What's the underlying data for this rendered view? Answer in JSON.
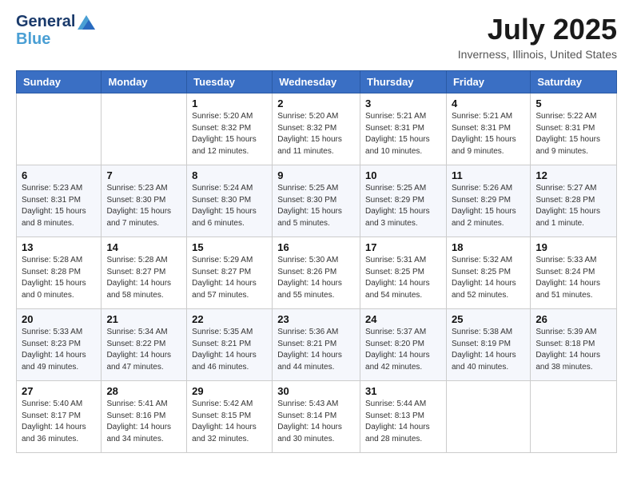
{
  "header": {
    "logo_line1": "General",
    "logo_line2": "Blue",
    "month_title": "July 2025",
    "location": "Inverness, Illinois, United States"
  },
  "weekdays": [
    "Sunday",
    "Monday",
    "Tuesday",
    "Wednesday",
    "Thursday",
    "Friday",
    "Saturday"
  ],
  "weeks": [
    [
      {
        "day": "",
        "info": ""
      },
      {
        "day": "",
        "info": ""
      },
      {
        "day": "1",
        "info": "Sunrise: 5:20 AM\nSunset: 8:32 PM\nDaylight: 15 hours and 12 minutes."
      },
      {
        "day": "2",
        "info": "Sunrise: 5:20 AM\nSunset: 8:32 PM\nDaylight: 15 hours and 11 minutes."
      },
      {
        "day": "3",
        "info": "Sunrise: 5:21 AM\nSunset: 8:31 PM\nDaylight: 15 hours and 10 minutes."
      },
      {
        "day": "4",
        "info": "Sunrise: 5:21 AM\nSunset: 8:31 PM\nDaylight: 15 hours and 9 minutes."
      },
      {
        "day": "5",
        "info": "Sunrise: 5:22 AM\nSunset: 8:31 PM\nDaylight: 15 hours and 9 minutes."
      }
    ],
    [
      {
        "day": "6",
        "info": "Sunrise: 5:23 AM\nSunset: 8:31 PM\nDaylight: 15 hours and 8 minutes."
      },
      {
        "day": "7",
        "info": "Sunrise: 5:23 AM\nSunset: 8:30 PM\nDaylight: 15 hours and 7 minutes."
      },
      {
        "day": "8",
        "info": "Sunrise: 5:24 AM\nSunset: 8:30 PM\nDaylight: 15 hours and 6 minutes."
      },
      {
        "day": "9",
        "info": "Sunrise: 5:25 AM\nSunset: 8:30 PM\nDaylight: 15 hours and 5 minutes."
      },
      {
        "day": "10",
        "info": "Sunrise: 5:25 AM\nSunset: 8:29 PM\nDaylight: 15 hours and 3 minutes."
      },
      {
        "day": "11",
        "info": "Sunrise: 5:26 AM\nSunset: 8:29 PM\nDaylight: 15 hours and 2 minutes."
      },
      {
        "day": "12",
        "info": "Sunrise: 5:27 AM\nSunset: 8:28 PM\nDaylight: 15 hours and 1 minute."
      }
    ],
    [
      {
        "day": "13",
        "info": "Sunrise: 5:28 AM\nSunset: 8:28 PM\nDaylight: 15 hours and 0 minutes."
      },
      {
        "day": "14",
        "info": "Sunrise: 5:28 AM\nSunset: 8:27 PM\nDaylight: 14 hours and 58 minutes."
      },
      {
        "day": "15",
        "info": "Sunrise: 5:29 AM\nSunset: 8:27 PM\nDaylight: 14 hours and 57 minutes."
      },
      {
        "day": "16",
        "info": "Sunrise: 5:30 AM\nSunset: 8:26 PM\nDaylight: 14 hours and 55 minutes."
      },
      {
        "day": "17",
        "info": "Sunrise: 5:31 AM\nSunset: 8:25 PM\nDaylight: 14 hours and 54 minutes."
      },
      {
        "day": "18",
        "info": "Sunrise: 5:32 AM\nSunset: 8:25 PM\nDaylight: 14 hours and 52 minutes."
      },
      {
        "day": "19",
        "info": "Sunrise: 5:33 AM\nSunset: 8:24 PM\nDaylight: 14 hours and 51 minutes."
      }
    ],
    [
      {
        "day": "20",
        "info": "Sunrise: 5:33 AM\nSunset: 8:23 PM\nDaylight: 14 hours and 49 minutes."
      },
      {
        "day": "21",
        "info": "Sunrise: 5:34 AM\nSunset: 8:22 PM\nDaylight: 14 hours and 47 minutes."
      },
      {
        "day": "22",
        "info": "Sunrise: 5:35 AM\nSunset: 8:21 PM\nDaylight: 14 hours and 46 minutes."
      },
      {
        "day": "23",
        "info": "Sunrise: 5:36 AM\nSunset: 8:21 PM\nDaylight: 14 hours and 44 minutes."
      },
      {
        "day": "24",
        "info": "Sunrise: 5:37 AM\nSunset: 8:20 PM\nDaylight: 14 hours and 42 minutes."
      },
      {
        "day": "25",
        "info": "Sunrise: 5:38 AM\nSunset: 8:19 PM\nDaylight: 14 hours and 40 minutes."
      },
      {
        "day": "26",
        "info": "Sunrise: 5:39 AM\nSunset: 8:18 PM\nDaylight: 14 hours and 38 minutes."
      }
    ],
    [
      {
        "day": "27",
        "info": "Sunrise: 5:40 AM\nSunset: 8:17 PM\nDaylight: 14 hours and 36 minutes."
      },
      {
        "day": "28",
        "info": "Sunrise: 5:41 AM\nSunset: 8:16 PM\nDaylight: 14 hours and 34 minutes."
      },
      {
        "day": "29",
        "info": "Sunrise: 5:42 AM\nSunset: 8:15 PM\nDaylight: 14 hours and 32 minutes."
      },
      {
        "day": "30",
        "info": "Sunrise: 5:43 AM\nSunset: 8:14 PM\nDaylight: 14 hours and 30 minutes."
      },
      {
        "day": "31",
        "info": "Sunrise: 5:44 AM\nSunset: 8:13 PM\nDaylight: 14 hours and 28 minutes."
      },
      {
        "day": "",
        "info": ""
      },
      {
        "day": "",
        "info": ""
      }
    ]
  ]
}
